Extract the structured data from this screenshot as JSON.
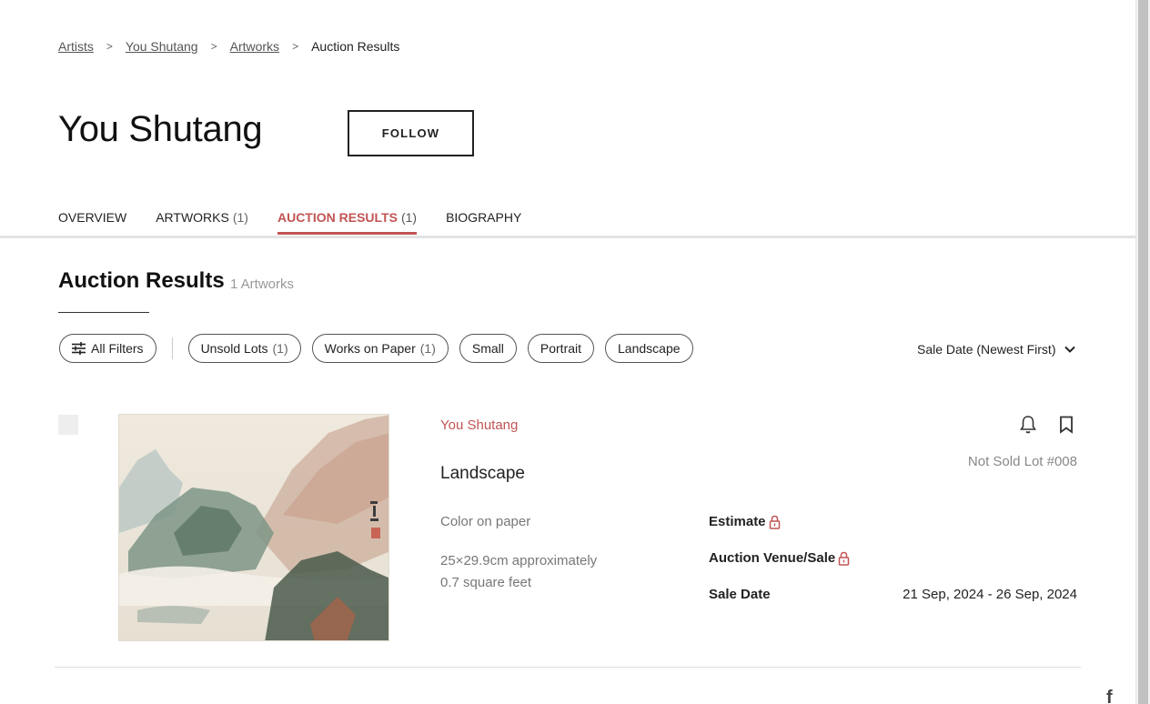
{
  "breadcrumb": {
    "items": [
      "Artists",
      "You Shutang",
      "Artworks"
    ],
    "current": "Auction Results",
    "separator": ">"
  },
  "artist": {
    "name": "You Shutang",
    "follow_label": "FOLLOW"
  },
  "tabs": [
    {
      "label": "OVERVIEW",
      "count": ""
    },
    {
      "label": "ARTWORKS",
      "count": "(1)"
    },
    {
      "label": "AUCTION RESULTS",
      "count": "(1)",
      "active": true
    },
    {
      "label": "BIOGRAPHY",
      "count": ""
    }
  ],
  "section": {
    "title": "Auction Results",
    "count_label": "1 Artworks"
  },
  "filters": {
    "all_filters_label": "All Filters",
    "pills": [
      {
        "label": "Unsold Lots",
        "count": "(1)"
      },
      {
        "label": "Works on Paper",
        "count": "(1)"
      },
      {
        "label": "Small",
        "count": ""
      },
      {
        "label": "Portrait",
        "count": ""
      },
      {
        "label": "Landscape",
        "count": ""
      }
    ]
  },
  "sort": {
    "label": "Sale Date (Newest First)"
  },
  "lot": {
    "artist": "You Shutang",
    "title": "Landscape",
    "medium": "Color on paper",
    "dimensions": "25×29.9cm approximately",
    "area": "0.7 square feet",
    "status": "Not Sold Lot #008",
    "estimate_label": "Estimate",
    "venue_label": "Auction Venue/Sale",
    "sale_date_label": "Sale Date",
    "sale_date_value": "21 Sep, 2024 - 26 Sep, 2024"
  },
  "colors": {
    "accent": "#c25454",
    "muted": "#777777"
  },
  "icons": [
    "filter-sliders-icon",
    "chevron-down-icon",
    "bell-icon",
    "bookmark-icon",
    "lock-icon",
    "facebook-icon"
  ]
}
